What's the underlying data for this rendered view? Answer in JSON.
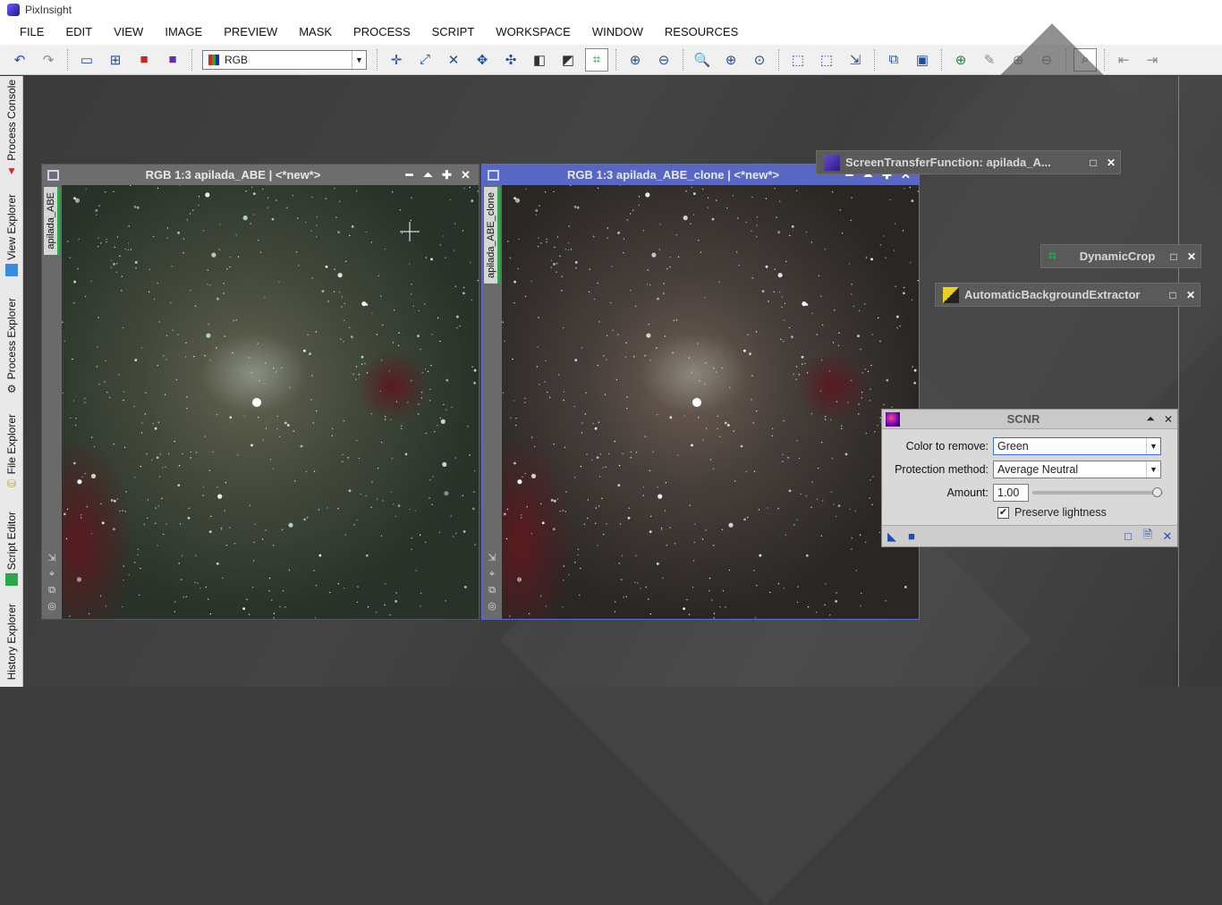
{
  "app": {
    "title": "PixInsight"
  },
  "menu": [
    "FILE",
    "EDIT",
    "VIEW",
    "IMAGE",
    "PREVIEW",
    "MASK",
    "PROCESS",
    "SCRIPT",
    "WORKSPACE",
    "WINDOW",
    "RESOURCES"
  ],
  "toolbar": {
    "channel_value": "RGB"
  },
  "sidebar": {
    "tabs": [
      "Process Console",
      "View Explorer",
      "Process Explorer",
      "File Explorer",
      "Script Editor",
      "History Explorer"
    ]
  },
  "windows": {
    "left": {
      "title": "RGB 1:3 apilada_ABE | <*new*>",
      "view_id": "apilada_ABE"
    },
    "right": {
      "title": "RGB 1:3 apilada_ABE_clone | <*new*>",
      "view_id": "apilada_ABE_clone"
    }
  },
  "tools": {
    "stf": "ScreenTransferFunction: apilada_A...",
    "crop": "DynamicCrop",
    "abe": "AutomaticBackgroundExtractor"
  },
  "scnr": {
    "title": "SCNR",
    "color_label": "Color to remove:",
    "color_value": "Green",
    "protection_label": "Protection method:",
    "protection_value": "Average Neutral",
    "amount_label": "Amount:",
    "amount_value": "1.00",
    "amount_fraction": 1.0,
    "preserve_label": "Preserve lightness",
    "preserve_checked": true
  },
  "colors": {
    "accent": "#5866c4",
    "workspace": "#3c3c3c",
    "dark_sky": "#2b2624"
  }
}
